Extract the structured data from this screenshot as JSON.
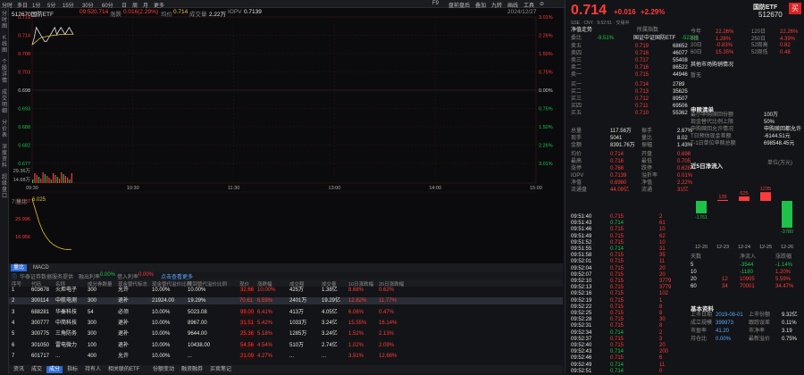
{
  "topbar": {
    "left": [
      "分时",
      "多日",
      "1分",
      "5分",
      "15分",
      "30分",
      "60分",
      "日",
      "周",
      "月",
      "更多"
    ],
    "right": [
      "F9",
      "盘前盘后",
      "叠加",
      "九转",
      "画线",
      "工具",
      "⊘"
    ]
  },
  "sidebar": [
    "分时图",
    "K线图",
    "个股详情",
    "成交明细",
    "分价表",
    "深度资料",
    "超级盘口"
  ],
  "chart": {
    "code": "512670国防ETF",
    "time": "09:52",
    "price": "0.714",
    "change_label": "涨跌",
    "change_val": "0.016(2.29%)",
    "avg_label": "均价",
    "avg": "0.714",
    "vol_label": "成交量",
    "vol": "2.22万",
    "iopv_label": "IOPV",
    "iopv": "0.7139",
    "date": "2024/12/27",
    "y_left": [
      "0.719",
      "0.714",
      "0.708",
      "0.703",
      "0.698",
      "0.693",
      "0.688",
      "0.682",
      "0.677",
      "29.36万",
      "14.68万"
    ],
    "y_right": [
      "3.01%",
      "2.26%",
      "1.50%",
      "0.75%",
      "0.00%",
      "0.75%",
      "1.50%",
      "2.26%",
      "3.01%"
    ],
    "x_ticks": [
      "09:30",
      "10:30",
      "11:30",
      "13:00",
      "14:00",
      "15:00"
    ],
    "sub_label": "7:量比",
    "sub_val": "6.025",
    "sub_y": [
      "34.037",
      "25.996",
      "16.956"
    ],
    "intraday_price": [
      0.711,
      0.713,
      0.716,
      0.715,
      0.714,
      0.713,
      0.712,
      0.712,
      0.713,
      0.714,
      0.715,
      0.716,
      0.714,
      0.715,
      0.716,
      0.715,
      0.714,
      0.715,
      0.716,
      0.715,
      0.714
    ],
    "intraday_avg": [
      0.711,
      0.7115,
      0.712,
      0.7125,
      0.713,
      0.7132,
      0.7133,
      0.7134,
      0.7135,
      0.7136,
      0.7137,
      0.7138,
      0.7138,
      0.7139,
      0.714,
      0.714,
      0.714,
      0.714,
      0.714,
      0.714,
      0.714
    ],
    "price_range": [
      0.677,
      0.719
    ],
    "ratio_curve": [
      34,
      30,
      26,
      23,
      21,
      19.5,
      18.5,
      17.8,
      17.3,
      17,
      16.9,
      16.95
    ]
  },
  "panel_tabs": [
    "量比",
    "MACD"
  ],
  "filter": {
    "text": "华泰证券数据服务提供",
    "ratio_label": "融出利率",
    "ratio_val": "0.00%",
    "in_label": "借入利率",
    "in_val": "0.00%",
    "hint": "点击查看更多"
  },
  "table": {
    "headers": [
      "序号",
      "代码",
      "名称",
      "成分券数量",
      "现金替代标志",
      "现金替代溢价比例",
      "赎回替代溢价比例",
      "现价",
      "涨跌幅",
      "成交额",
      "成交量",
      "10日涨跌幅",
      "20日涨跌幅"
    ],
    "rows": [
      [
        "1",
        "603678",
        "火炬电子",
        "300",
        "允许",
        "10.00%",
        "10.00%",
        "32.66",
        "10.00%",
        "425万",
        "1.38亿",
        "8.68%",
        "0.62%"
      ],
      [
        "2",
        "300114",
        "中航电测",
        "300",
        "退补",
        "21924.00",
        "19.29%",
        "70.61",
        "6.59%",
        "2401万",
        "19.29亿",
        "12.82%",
        "11.77%"
      ],
      [
        "3",
        "688281",
        "华秦科技",
        "54",
        "必须",
        "10.00%",
        "5023.08",
        "99.00",
        "6.41%",
        "413万",
        "4.05亿",
        "6.06%",
        "0.47%"
      ],
      [
        "4",
        "300777",
        "中简科技",
        "300",
        "退补",
        "10.00%",
        "8967.00",
        "31.51",
        "5.42%",
        "1033万",
        "3.24亿",
        "15.55%",
        "16.14%"
      ],
      [
        "5",
        "300775",
        "三角防务",
        "300",
        "退补",
        "10.00%",
        "9644.00",
        "25.36",
        "5.18%",
        "1285万",
        "3.24亿",
        "1.52%",
        "2.13%"
      ],
      [
        "6",
        "301050",
        "雷电微力",
        "100",
        "退补",
        "10.00%",
        "10438.00",
        "54.56",
        "4.54%",
        "510万",
        "2.74亿",
        "1.02%",
        "2.09%"
      ],
      [
        "7",
        "601717",
        "...",
        "400",
        "允许",
        "10.00%",
        "...",
        "21.09",
        "4.27%",
        "...",
        "...",
        "3.91%",
        "12.66%"
      ]
    ]
  },
  "bottom_tabs": [
    "资讯",
    "成交",
    "成分",
    "指标",
    "持有人",
    "相关联的ETF",
    "份额变动",
    "融资融券",
    "买卖笔记"
  ],
  "right": {
    "price": "0.714",
    "chg": "+0.016",
    "pct": "+2.29%",
    "name": "国防ETF",
    "code": "512670",
    "buy": "买",
    "sub": "SSE · CNY · 9:52:51 · 交易中",
    "net": "净值走势",
    "belong": "所属指数",
    "wb_label": "委比",
    "wb": "-9.51%",
    "idx": "国证中证国防ETF",
    "wc": "-52396",
    "asks": [
      [
        "卖五",
        "0.719",
        "68652"
      ],
      [
        "卖四",
        "0.718",
        "46077"
      ],
      [
        "卖三",
        "0.717",
        "55408"
      ],
      [
        "卖二",
        "0.716",
        "86522"
      ],
      [
        "卖一",
        "0.715",
        "44946"
      ]
    ],
    "bids": [
      [
        "买一",
        "0.714",
        "2789"
      ],
      [
        "买二",
        "0.713",
        "35625"
      ],
      [
        "买三",
        "0.712",
        "89507"
      ],
      [
        "买四",
        "0.711",
        "69506"
      ],
      [
        "买五",
        "0.710",
        "55362"
      ]
    ],
    "perf": [
      [
        "今年",
        "22.26%",
        "120日",
        "22.26%"
      ],
      [
        "5日",
        "1.28%",
        "250日",
        "4.39%"
      ],
      [
        "20日",
        "-0.83%",
        "52周高",
        "0.82"
      ],
      [
        "60日",
        "15.35%",
        "52周低",
        "0.48"
      ]
    ],
    "mod": "其他市场购销情况",
    "mod2": "暂无",
    "stats": [
      [
        "总量",
        "117.56万",
        "振手",
        "2.67%"
      ],
      [
        "现手",
        "5041",
        "量比",
        "8.02"
      ],
      [
        "金额",
        "8391.76万",
        "振幅",
        "1.43%"
      ]
    ],
    "qs": [
      [
        "均价",
        "0.714",
        "开盘",
        "0.698"
      ],
      [
        "最高",
        "0.716",
        "最低",
        "0.705"
      ],
      [
        "涨停",
        "0.768",
        "跌停",
        "0.628"
      ],
      [
        "IOPV",
        "0.7139",
        "溢折率",
        "0.01%"
      ],
      [
        "净值",
        "0.6980",
        "净值",
        "2.22%"
      ],
      [
        "流通盘",
        "44.09亿",
        "流通",
        "31亿"
      ]
    ],
    "info_title": "申赎清单",
    "info": [
      [
        "最小申购赎回份额",
        "100万"
      ],
      [
        "现金替代比例上限",
        "50%"
      ],
      [
        "申购赎回允许情况",
        "申购赎回都允许"
      ],
      [
        "T日预估现金差额",
        "-6144.51元"
      ],
      [
        "T-1日单位申赎总额",
        "698548.45元"
      ]
    ],
    "flow_title": "近5日净流入",
    "flow_unit": "单位(万元)",
    "flow_labels": [
      "12-20",
      "12-23",
      "12-24",
      "12-25",
      "12-26"
    ],
    "flow_vals": [
      -1761,
      135,
      625,
      1235,
      -3780
    ],
    "ticks": [
      [
        "09:51:40",
        "0.715",
        "2"
      ],
      [
        "09:51:43",
        "0.714",
        "61"
      ],
      [
        "09:51:46",
        "0.715",
        "10"
      ],
      [
        "09:51:49",
        "0.715",
        "62"
      ],
      [
        "09:51:52",
        "0.715",
        "10"
      ],
      [
        "09:51:55",
        "0.714",
        "31"
      ],
      [
        "09:51:58",
        "0.715",
        "35"
      ],
      [
        "09:52:01",
        "0.715",
        "11"
      ],
      [
        "09:52:04",
        "0.715",
        "20"
      ],
      [
        "09:52:07",
        "0.715",
        "20"
      ],
      [
        "09:52:10",
        "0.715",
        "3779"
      ],
      [
        "09:52:13",
        "0.715",
        "3779"
      ],
      [
        "09:52:16",
        "0.715",
        "102"
      ],
      [
        "09:52:19",
        "0.715",
        "1"
      ],
      [
        "09:52:22",
        "0.715",
        "8"
      ],
      [
        "09:52:25",
        "0.715",
        "8"
      ],
      [
        "09:52:28",
        "0.715",
        "30"
      ],
      [
        "09:52:31",
        "0.715",
        "8"
      ],
      [
        "09:52:34",
        "0.714",
        "2"
      ],
      [
        "09:52:37",
        "0.715",
        "3"
      ],
      [
        "09:52:40",
        "0.715",
        "20"
      ],
      [
        "09:52:43",
        "0.714",
        "200"
      ],
      [
        "09:52:46",
        "0.715",
        "6"
      ],
      [
        "09:52:49",
        "0.714",
        "11"
      ],
      [
        "09:52:51",
        "0.714",
        "0"
      ]
    ],
    "ftable_head": [
      "天数",
      "净流入",
      "涨跌幅"
    ],
    "ftable": [
      [
        "5",
        "-3544",
        "-1.14%"
      ],
      [
        "10",
        "-1180",
        "1.20%"
      ],
      [
        "20",
        "12",
        "10905",
        "5.59%"
      ],
      [
        "60",
        "34",
        "70001",
        "34.47%"
      ]
    ],
    "base_title": "基本资料",
    "base": [
      [
        "上市日期",
        "2019-08-01",
        "上市份额",
        "9.32亿"
      ],
      [
        "成立规模",
        "399973",
        "跟踪误差",
        "0.11%"
      ],
      [
        "市盈率",
        "41.20",
        "市净率",
        "3.19"
      ],
      [
        "持仓比",
        "0.00%",
        "最新溢价",
        "0.75%"
      ]
    ]
  }
}
